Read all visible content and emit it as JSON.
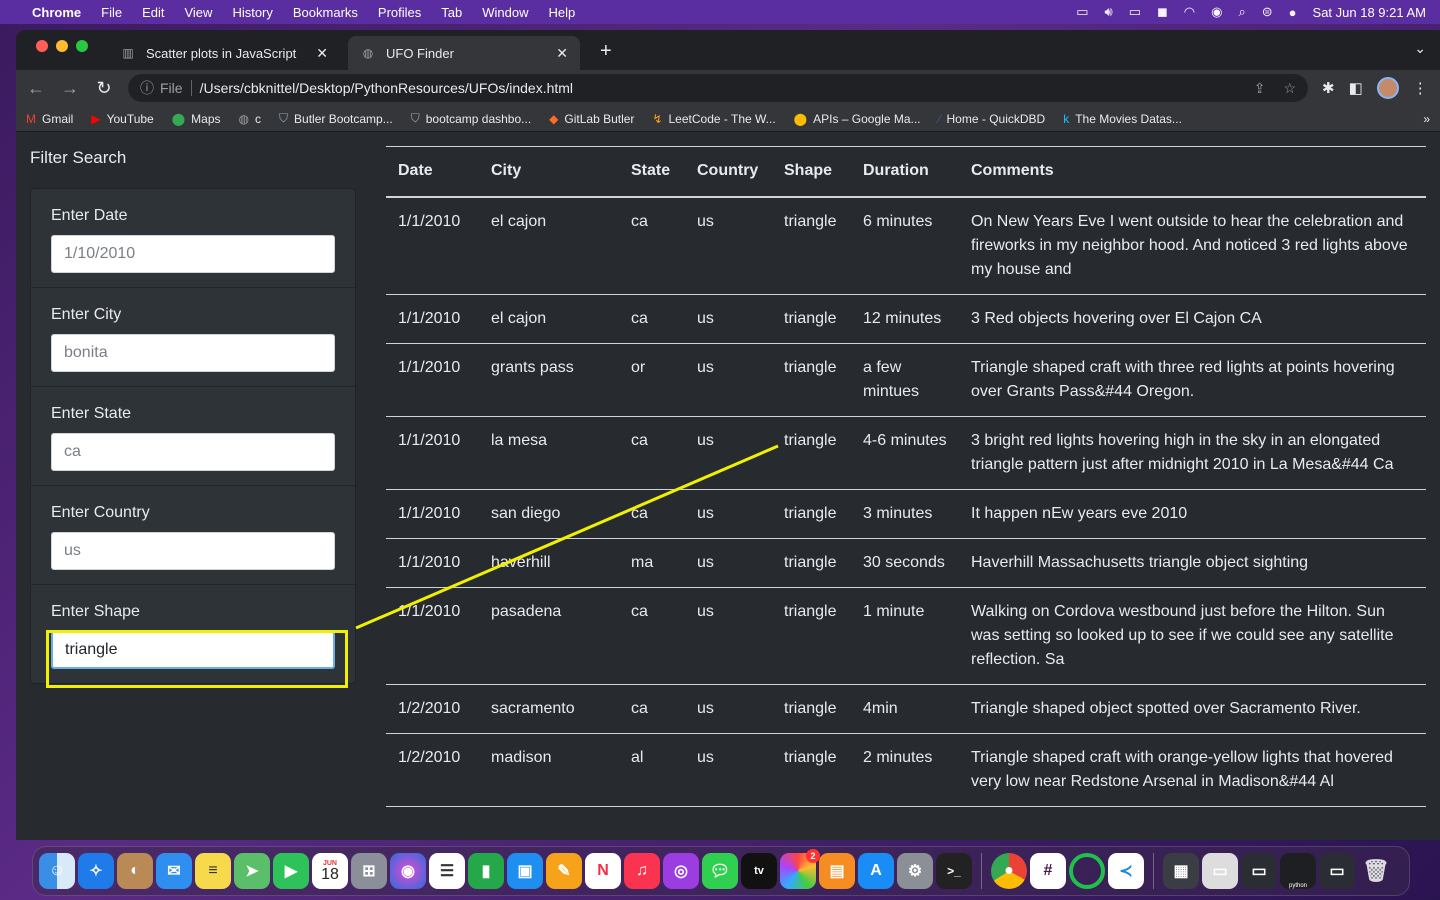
{
  "menubar": {
    "app": "Chrome",
    "items": [
      "File",
      "Edit",
      "View",
      "History",
      "Bookmarks",
      "Profiles",
      "Tab",
      "Window",
      "Help"
    ],
    "datetime": "Sat Jun 18  9:21 AM"
  },
  "browser": {
    "tabs": [
      {
        "title": "Scatter plots in JavaScript",
        "active": false
      },
      {
        "title": "UFO Finder",
        "active": true
      }
    ],
    "file_label": "File",
    "url": "/Users/cbknittel/Desktop/PythonResources/UFOs/index.html",
    "bookmarks": [
      "Gmail",
      "YouTube",
      "Maps",
      "c",
      "Butler Bootcamp...",
      "bootcamp dashbo...",
      "GitLab Butler",
      "LeetCode - The W...",
      "APIs – Google Ma...",
      "Home - QuickDBD",
      "The Movies Datas..."
    ]
  },
  "sidebar": {
    "title": "Filter Search",
    "filters": [
      {
        "label": "Enter Date",
        "placeholder": "1/10/2010",
        "value": ""
      },
      {
        "label": "Enter City",
        "placeholder": "bonita",
        "value": ""
      },
      {
        "label": "Enter State",
        "placeholder": "ca",
        "value": ""
      },
      {
        "label": "Enter Country",
        "placeholder": "us",
        "value": ""
      },
      {
        "label": "Enter Shape",
        "placeholder": "",
        "value": "triangle"
      }
    ]
  },
  "table": {
    "headers": [
      "Date",
      "City",
      "State",
      "Country",
      "Shape",
      "Duration",
      "Comments"
    ],
    "rows": [
      [
        "1/1/2010",
        "el cajon",
        "ca",
        "us",
        "triangle",
        "6 minutes",
        "On New Years Eve I went outside to hear the celebration and fireworks in my neighbor hood. And noticed 3 red lights above my house and"
      ],
      [
        "1/1/2010",
        "el cajon",
        "ca",
        "us",
        "triangle",
        "12 minutes",
        "3 Red objects hovering over El Cajon CA"
      ],
      [
        "1/1/2010",
        "grants pass",
        "or",
        "us",
        "triangle",
        "a few mintues",
        "Triangle shaped craft with three red lights at points hovering over Grants Pass&#44 Oregon."
      ],
      [
        "1/1/2010",
        "la mesa",
        "ca",
        "us",
        "triangle",
        "4-6 minutes",
        "3 bright red lights hovering high in the sky in an elongated triangle pattern just after midnight 2010 in La Mesa&#44 Ca"
      ],
      [
        "1/1/2010",
        "san diego",
        "ca",
        "us",
        "triangle",
        "3 minutes",
        "It happen nEw years eve 2010"
      ],
      [
        "1/1/2010",
        "haverhill",
        "ma",
        "us",
        "triangle",
        "30 seconds",
        "Haverhill Massachusetts triangle object sighting"
      ],
      [
        "1/1/2010",
        "pasadena",
        "ca",
        "us",
        "triangle",
        "1 minute",
        "Walking on Cordova westbound just before the Hilton. Sun was setting so looked up to see if we could see any satellite reflection. Sa"
      ],
      [
        "1/2/2010",
        "sacramento",
        "ca",
        "us",
        "triangle",
        "4min",
        "Triangle shaped object spotted over Sacramento River."
      ],
      [
        "1/2/2010",
        "madison",
        "al",
        "us",
        "triangle",
        "2 minutes",
        "Triangle shaped craft with orange-yellow lights that hovered very low near Redstone Arsenal in Madison&#44 Al"
      ]
    ]
  },
  "annotation": {
    "color": "#f0f000"
  },
  "dock": {
    "calendar_month": "JUN",
    "calendar_day": "18",
    "photos_badge": "2",
    "python_label": "python"
  }
}
